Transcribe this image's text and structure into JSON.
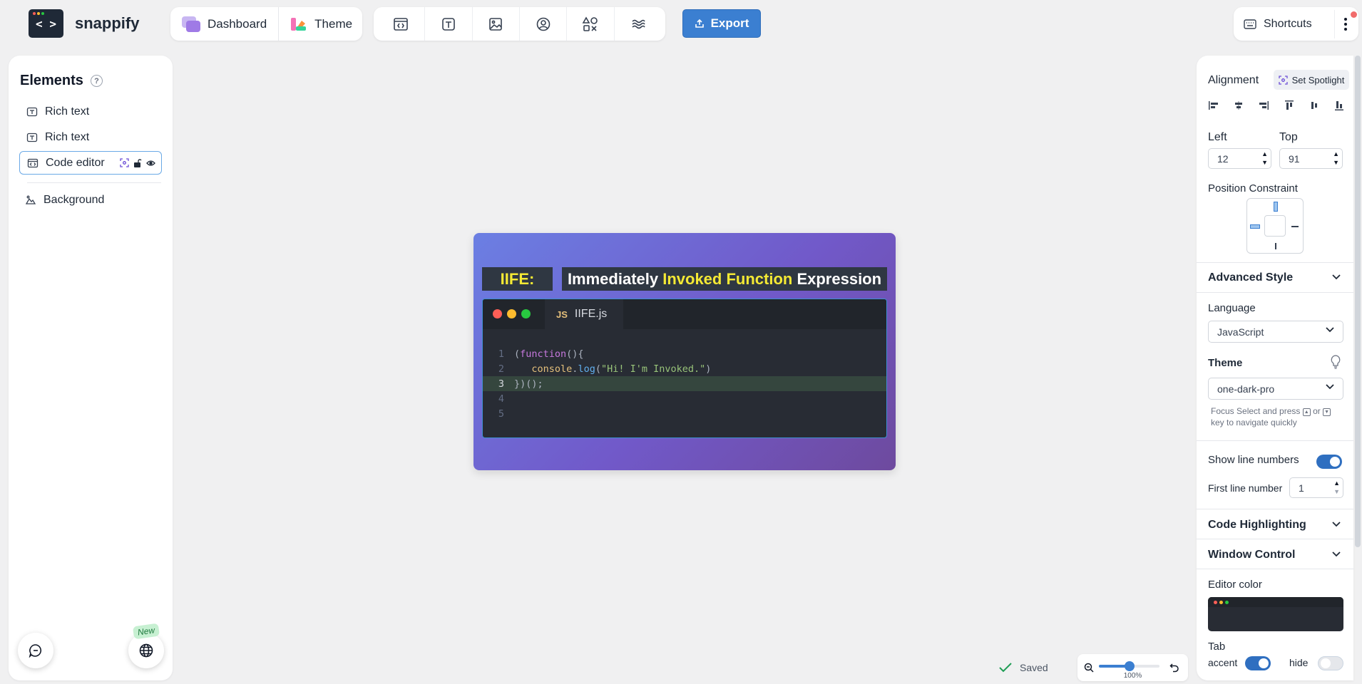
{
  "app": {
    "name": "snappify"
  },
  "nav": {
    "dashboard_label": "Dashboard",
    "theme_label": "Theme"
  },
  "toolbar": {
    "tools": [
      "code-editor-icon",
      "rich-text-icon",
      "image-icon",
      "avatar-icon",
      "shapes-icon",
      "background-waves-icon"
    ],
    "export_label": "Export",
    "shortcuts_label": "Shortcuts"
  },
  "elements_panel": {
    "title": "Elements",
    "items": [
      {
        "label": "Rich text"
      },
      {
        "label": "Rich text"
      },
      {
        "label": "Code editor",
        "selected": true
      }
    ],
    "background_label": "Background",
    "new_badge": "New"
  },
  "canvas": {
    "title_left": "IIFE:",
    "title_right": {
      "part1": "Immediately ",
      "part2": "Invoked Function",
      "part3": " Expression"
    },
    "tab_icon": "JS",
    "tab_name": "IIFE.js",
    "code_lines": [
      {
        "num": "1"
      },
      {
        "num": "2"
      },
      {
        "num": "3",
        "highlighted": true
      },
      {
        "num": "4"
      },
      {
        "num": "5"
      }
    ],
    "code": {
      "l1_kw": "function",
      "l2_obj": "console",
      "l2_fn": "log",
      "l2_str": "\"Hi! I'm Invoked.\"",
      "l3": "})();"
    }
  },
  "status": {
    "saved_label": "Saved",
    "zoom_label": "100%",
    "zoom_level": 0.5
  },
  "inspector": {
    "alignment_label": "Alignment",
    "spotlight_label": "Set Spotlight",
    "left_label": "Left",
    "left_value": "12",
    "top_label": "Top",
    "top_value": "91",
    "position_constraint_label": "Position Constraint",
    "advanced_style_label": "Advanced Style",
    "language_label": "Language",
    "language_value": "JavaScript",
    "theme_label": "Theme",
    "theme_value": "one-dark-pro",
    "hint_part1": "Focus Select and press",
    "hint_or": "or",
    "hint_part2": "key to navigate quickly",
    "show_line_numbers_label": "Show line numbers",
    "show_line_numbers": true,
    "first_line_number_label": "First line number",
    "first_line_number_value": "1",
    "code_highlighting_label": "Code Highlighting",
    "window_control_label": "Window Control",
    "editor_color_label": "Editor color",
    "tab_label": "Tab",
    "accent_label": "accent",
    "accent_on": true,
    "hide_label": "hide",
    "hide_on": false
  },
  "colors": {
    "accent": "#3b7fd1",
    "canvas_gradient_start": "#6b7fe3",
    "canvas_gradient_end": "#6e4a9e",
    "title_highlight": "#f4e934",
    "editor_bg": "#282c34",
    "dot_red": "#ff5f57",
    "dot_yellow": "#febc2e",
    "dot_green": "#28c840"
  }
}
